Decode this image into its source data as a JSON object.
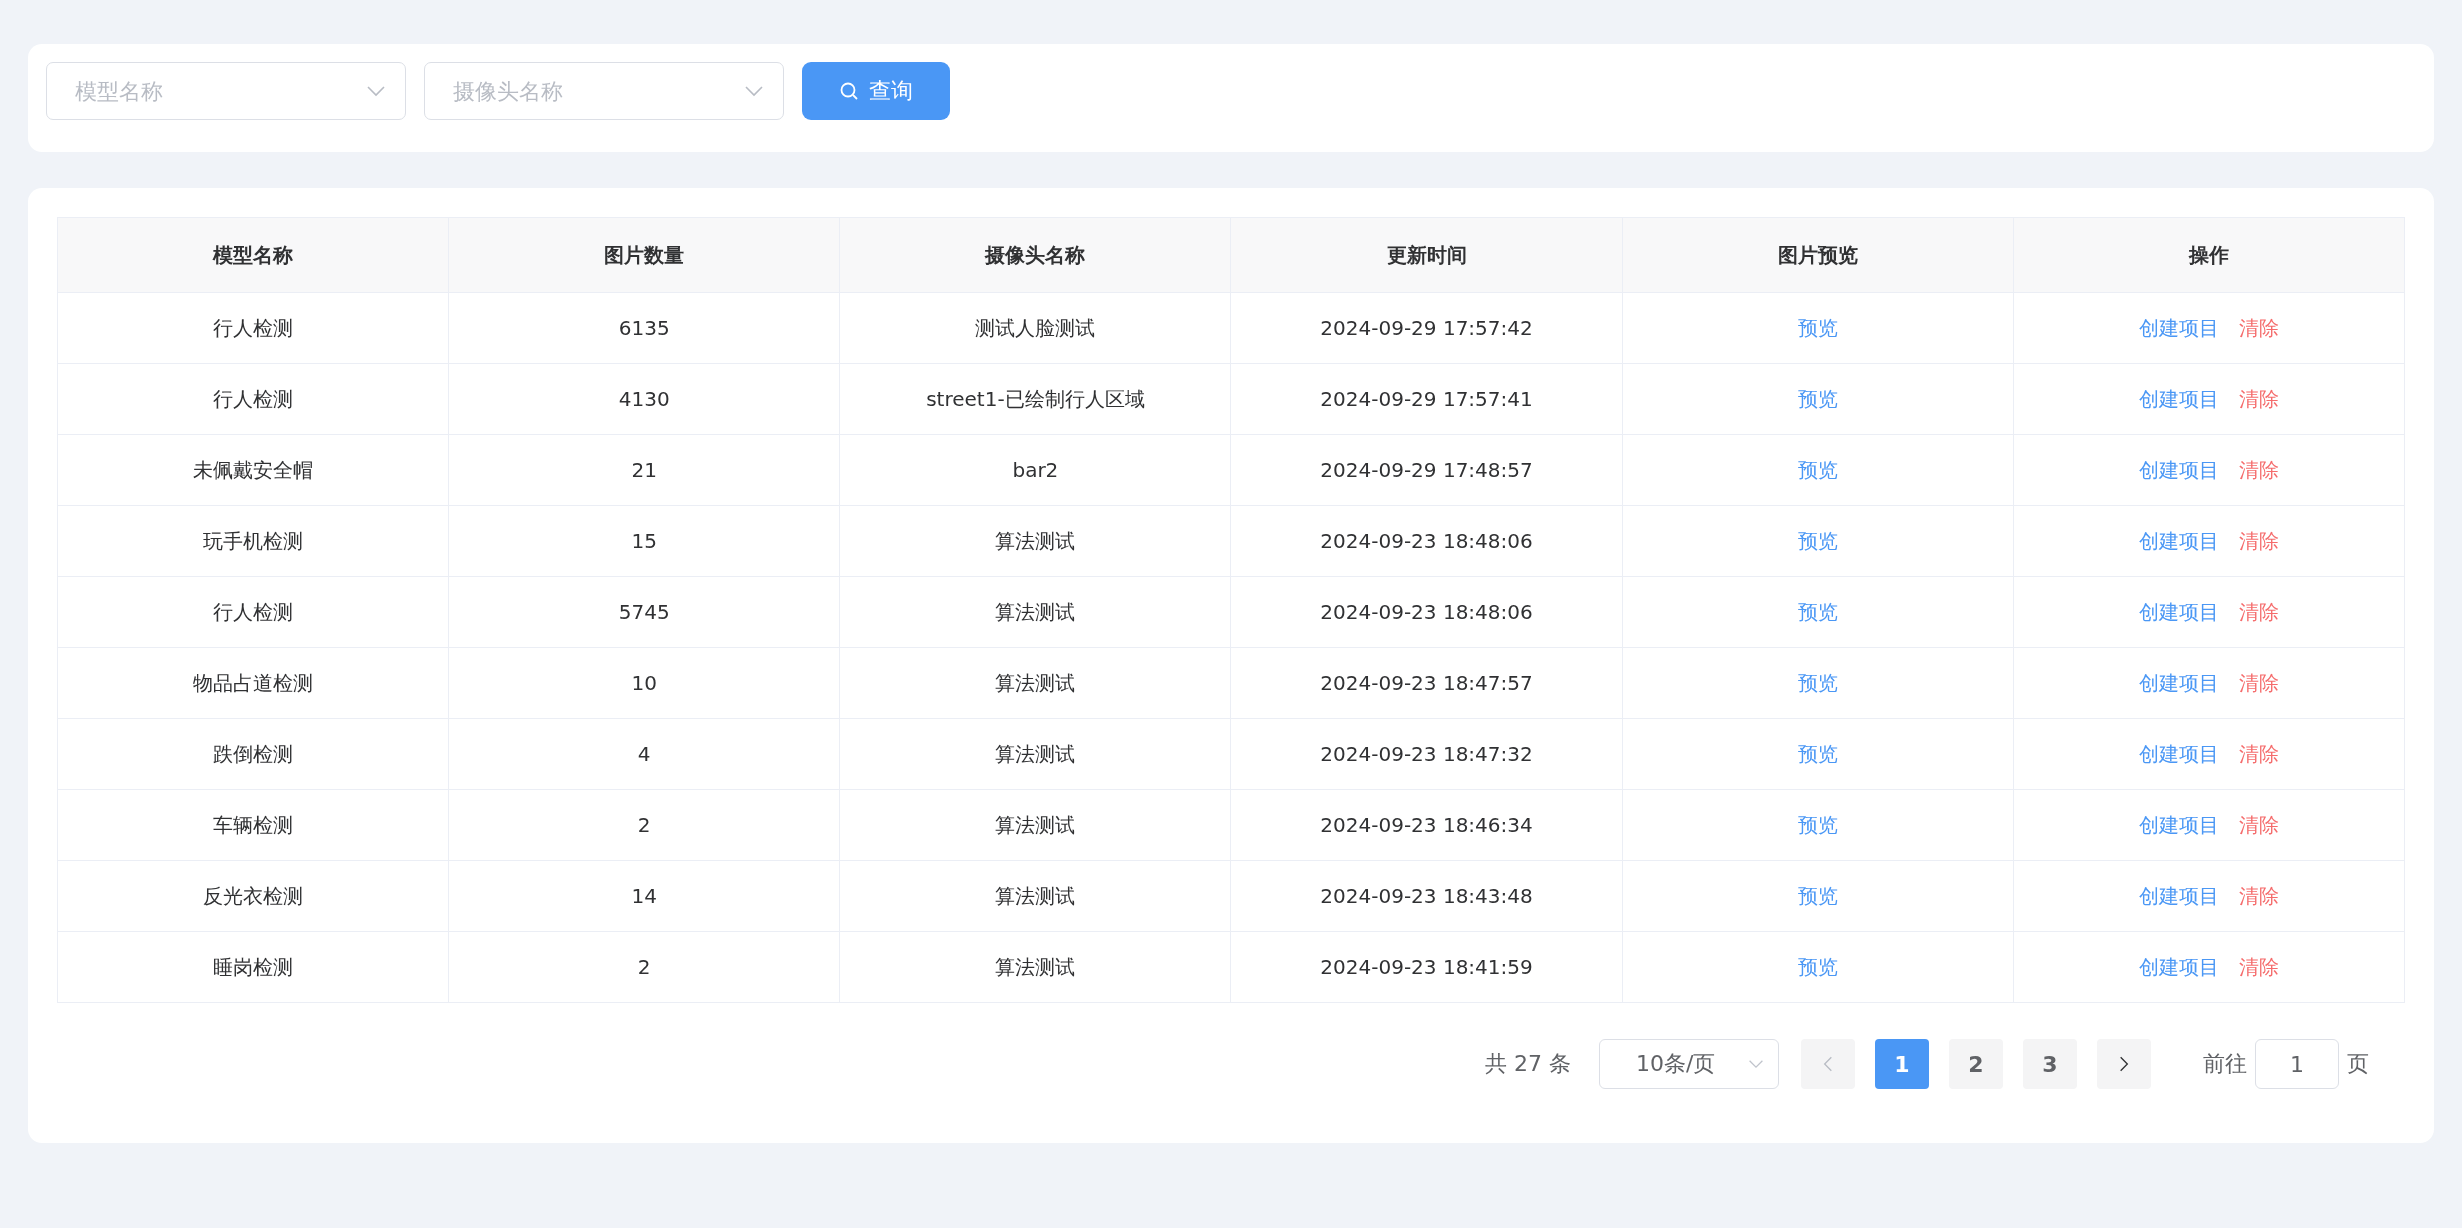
{
  "filters": {
    "model_select": {
      "placeholder": "模型名称"
    },
    "camera_select": {
      "placeholder": "摄像头名称"
    },
    "query_button": "查询"
  },
  "table": {
    "columns": [
      "模型名称",
      "图片数量",
      "摄像头名称",
      "更新时间",
      "图片预览",
      "操作"
    ],
    "rows": [
      {
        "model": "行人检测",
        "count": "6135",
        "camera": "测试人脸测试",
        "time": "2024-09-29 17:57:42",
        "preview": "预览",
        "create": "创建项目",
        "clear": "清除"
      },
      {
        "model": "行人检测",
        "count": "4130",
        "camera": "street1-已绘制行人区域",
        "time": "2024-09-29 17:57:41",
        "preview": "预览",
        "create": "创建项目",
        "clear": "清除"
      },
      {
        "model": "未佩戴安全帽",
        "count": "21",
        "camera": "bar2",
        "time": "2024-09-29 17:48:57",
        "preview": "预览",
        "create": "创建项目",
        "clear": "清除"
      },
      {
        "model": "玩手机检测",
        "count": "15",
        "camera": "算法测试",
        "time": "2024-09-23 18:48:06",
        "preview": "预览",
        "create": "创建项目",
        "clear": "清除"
      },
      {
        "model": "行人检测",
        "count": "5745",
        "camera": "算法测试",
        "time": "2024-09-23 18:48:06",
        "preview": "预览",
        "create": "创建项目",
        "clear": "清除"
      },
      {
        "model": "物品占道检测",
        "count": "10",
        "camera": "算法测试",
        "time": "2024-09-23 18:47:57",
        "preview": "预览",
        "create": "创建项目",
        "clear": "清除"
      },
      {
        "model": "跌倒检测",
        "count": "4",
        "camera": "算法测试",
        "time": "2024-09-23 18:47:32",
        "preview": "预览",
        "create": "创建项目",
        "clear": "清除"
      },
      {
        "model": "车辆检测",
        "count": "2",
        "camera": "算法测试",
        "time": "2024-09-23 18:46:34",
        "preview": "预览",
        "create": "创建项目",
        "clear": "清除"
      },
      {
        "model": "反光衣检测",
        "count": "14",
        "camera": "算法测试",
        "time": "2024-09-23 18:43:48",
        "preview": "预览",
        "create": "创建项目",
        "clear": "清除"
      },
      {
        "model": "睡岗检测",
        "count": "2",
        "camera": "算法测试",
        "time": "2024-09-23 18:41:59",
        "preview": "预览",
        "create": "创建项目",
        "clear": "清除"
      }
    ]
  },
  "pagination": {
    "total": "共 27 条",
    "page_size": "10条/页",
    "prev_disabled": true,
    "pages": [
      {
        "label": "1",
        "selected": true
      },
      {
        "label": "2",
        "selected": false
      },
      {
        "label": "3",
        "selected": false
      }
    ],
    "goto_label": "前往",
    "goto_value": "1",
    "page_suffix": "页"
  }
}
